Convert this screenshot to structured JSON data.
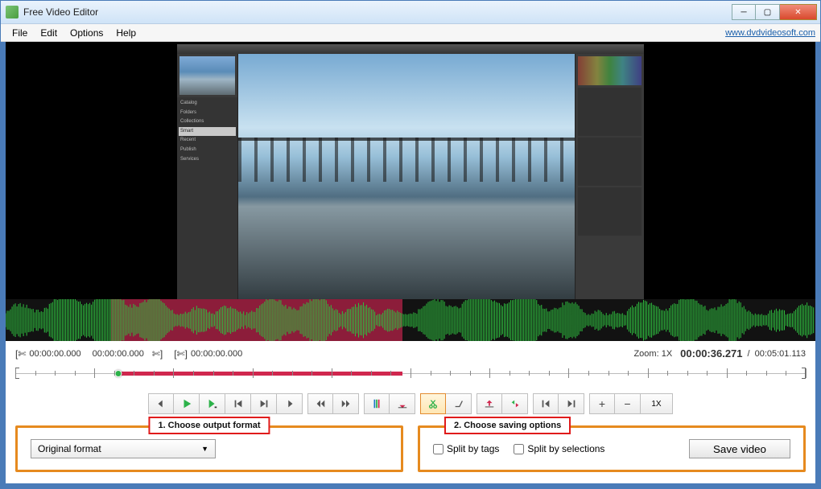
{
  "window": {
    "title": "Free Video Editor",
    "site_link": "www.dvdvideosoft.com"
  },
  "menu": {
    "file": "File",
    "edit": "Edit",
    "options": "Options",
    "help": "Help"
  },
  "timecodes": {
    "in_tc": "00:00:00.000",
    "out_tc": "00:00:00.000",
    "cut_tc": "00:00:00.000",
    "zoom_label": "Zoom:",
    "zoom_value": "1X",
    "position": "00:00:36.271",
    "sep": "/",
    "duration": "00:05:01.113"
  },
  "toolbar": {
    "zoom_reset": "1X"
  },
  "callouts": {
    "format": "1. Choose output format",
    "saving": "2. Choose saving options"
  },
  "format": {
    "selected": "Original format"
  },
  "saving": {
    "split_tags": "Split by tags",
    "split_sel": "Split by selections",
    "save_btn": "Save video"
  }
}
